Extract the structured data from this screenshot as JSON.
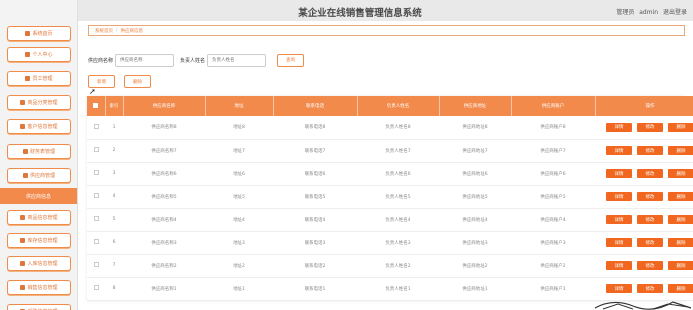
{
  "header": {
    "title": "某企业在线销售管理信息系统",
    "user_prefix": "管理员",
    "username": "admin",
    "logout": "退出登录"
  },
  "sidebar": {
    "items": [
      {
        "label": "系统首页",
        "icon": "home-icon",
        "active": false
      },
      {
        "label": "个人中心",
        "icon": "user-icon",
        "active": false
      },
      {
        "label": "员工管理",
        "icon": "staff-icon",
        "active": false
      },
      {
        "label": "商品分类管理",
        "icon": "category-icon",
        "active": false
      },
      {
        "label": "客户信息管理",
        "icon": "customer-icon",
        "active": false
      },
      {
        "label": "财务表管理",
        "icon": "finance-icon",
        "active": false
      },
      {
        "label": "供应商管理",
        "icon": "supplier-icon",
        "active": false
      },
      {
        "label": "供应商信息",
        "icon": "",
        "active": true
      },
      {
        "label": "商品信息管理",
        "icon": "goods-icon",
        "active": false
      },
      {
        "label": "库存信息管理",
        "icon": "stock-icon",
        "active": false
      },
      {
        "label": "入库信息管理",
        "icon": "inbound-icon",
        "active": false
      },
      {
        "label": "销售信息管理",
        "icon": "sales-icon",
        "active": false
      },
      {
        "label": "采购信息管理",
        "icon": "purchase-icon",
        "active": false
      }
    ]
  },
  "breadcrumb": {
    "home": "系统首页",
    "current": "供应商信息"
  },
  "search": {
    "name_label": "供应商名称",
    "name_placeholder": "供应商名称",
    "contact_label": "负责人姓名",
    "contact_placeholder": "负责人姓名",
    "query": "查询"
  },
  "actions": {
    "add": "新增",
    "delete": "删除"
  },
  "table": {
    "columns": [
      "索引",
      "供应商名称",
      "地址",
      "联系电话",
      "负责人姓名",
      "供应商地址",
      "供应商账户",
      "操作"
    ],
    "row_buttons": {
      "detail": "详情",
      "edit": "修改",
      "delete": "删除"
    },
    "rows": [
      [
        "1",
        "供应商名称8",
        "地址8",
        "联系电话8",
        "负责人姓名8",
        "供应商地址8",
        "供应商账户8"
      ],
      [
        "2",
        "供应商名称7",
        "地址7",
        "联系电话7",
        "负责人姓名7",
        "供应商地址7",
        "供应商账户7"
      ],
      [
        "3",
        "供应商名称6",
        "地址6",
        "联系电话6",
        "负责人姓名6",
        "供应商地址6",
        "供应商账户6"
      ],
      [
        "4",
        "供应商名称5",
        "地址5",
        "联系电话5",
        "负责人姓名5",
        "供应商地址5",
        "供应商账户5"
      ],
      [
        "5",
        "供应商名称4",
        "地址4",
        "联系电话4",
        "负责人姓名4",
        "供应商地址4",
        "供应商账户4"
      ],
      [
        "6",
        "供应商名称3",
        "地址3",
        "联系电话3",
        "负责人姓名3",
        "供应商地址3",
        "供应商账户3"
      ],
      [
        "7",
        "供应商名称2",
        "地址2",
        "联系电话2",
        "负责人姓名2",
        "供应商地址2",
        "供应商账户2"
      ],
      [
        "8",
        "供应商名称1",
        "地址1",
        "联系电话1",
        "负责人姓名1",
        "供应商地址1",
        "供应商账户1"
      ]
    ]
  },
  "colors": {
    "accent": "#f28a4c",
    "button": "#f2671f",
    "topbar": "#e9e9e9"
  }
}
